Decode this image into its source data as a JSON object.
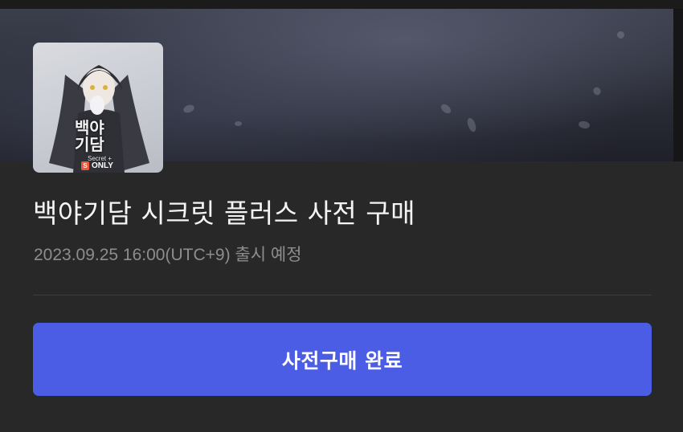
{
  "product": {
    "cover": {
      "title_art": "백야기담",
      "subtitle": "Secret +",
      "badge_mark": "S",
      "badge_text": "ONLY"
    },
    "title": "백야기담 시크릿 플러스 사전 구매",
    "release_text": "2023.09.25 16:00(UTC+9) 출시 예정"
  },
  "cta": {
    "label": "사전구매 완료"
  },
  "colors": {
    "background": "#282828",
    "accent": "#4b5de4",
    "title_text": "#f4f4f4",
    "muted_text": "#8d8d8d"
  }
}
